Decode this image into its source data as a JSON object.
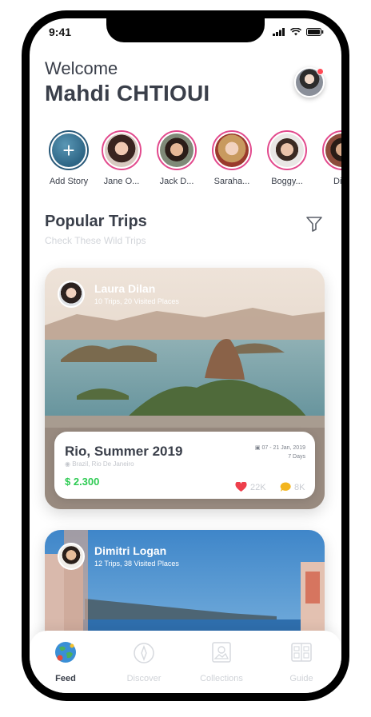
{
  "status_bar": {
    "time": "9:41"
  },
  "header": {
    "greeting": "Welcome",
    "username": "Mahdi CHTIOUI"
  },
  "stories": [
    {
      "label": "Add Story"
    },
    {
      "label": "Jane O..."
    },
    {
      "label": "Jack D..."
    },
    {
      "label": "Saraha..."
    },
    {
      "label": "Boggy..."
    },
    {
      "label": "Dimi"
    }
  ],
  "section": {
    "title": "Popular Trips",
    "subtitle": "Check These Wild Trips"
  },
  "trips": [
    {
      "author": "Laura Dilan",
      "stats": "10 Trips, 20 Visited Places",
      "title": "Rio, Summer 2019",
      "location": "Brazil, Rio De Janeiro",
      "price": "$ 2.300",
      "dates": "07 - 21 Jan, 2019",
      "duration": "7 Days",
      "likes": "22K",
      "comments": "8K"
    },
    {
      "author": "Dimitri Logan",
      "stats": "12 Trips, 38 Visited Places"
    }
  ],
  "tabs": [
    {
      "label": "Feed",
      "icon": "globe-icon",
      "active": true
    },
    {
      "label": "Discover",
      "icon": "compass-icon"
    },
    {
      "label": "Collections",
      "icon": "gallery-icon"
    },
    {
      "label": "Guide",
      "icon": "map-guide-icon"
    }
  ],
  "colors": {
    "price": "#2ecb53",
    "story_ring": "#e24a8d",
    "notification": "#ff4a55",
    "text_dark": "#3a3f4a"
  }
}
